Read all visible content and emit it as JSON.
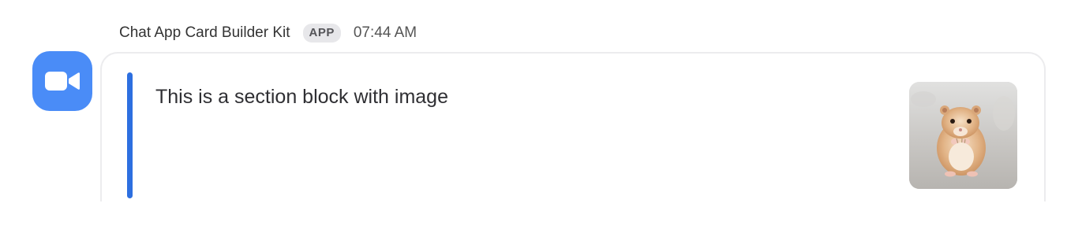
{
  "message": {
    "sender_name": "Chat App Card Builder Kit",
    "badge": "APP",
    "timestamp": "07:44 AM",
    "avatar_icon": "video-camera-icon",
    "avatar_color": "#4a8cf7"
  },
  "card": {
    "accent_color": "#2d6fe0",
    "section_text": "This is a section block with image",
    "section_image": "hamster-photo"
  }
}
